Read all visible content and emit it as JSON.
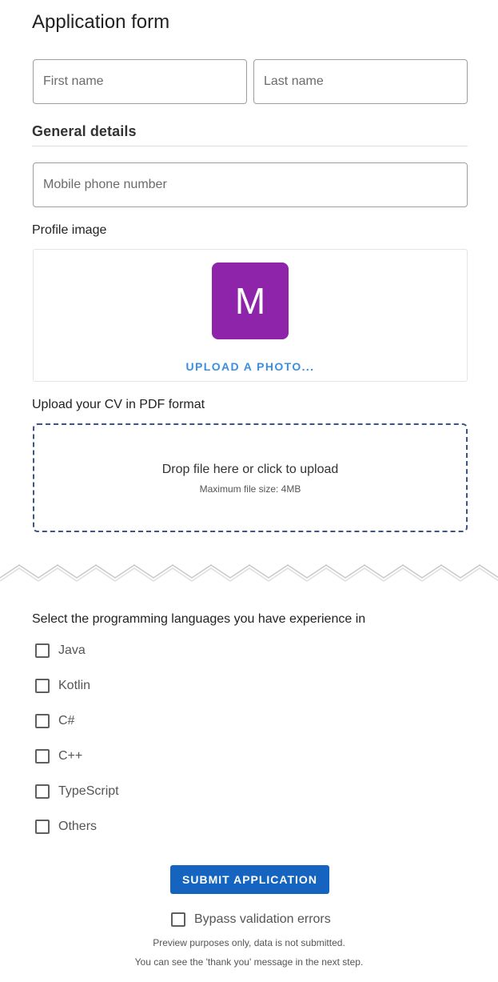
{
  "form": {
    "title": "Application form",
    "first_name_placeholder": "First name",
    "last_name_placeholder": "Last name",
    "general_details_heading": "General details",
    "phone_placeholder": "Mobile phone number",
    "profile_image_label": "Profile image",
    "avatar_initial": "M",
    "avatar_color": "#8e24aa",
    "upload_photo_label": "UPLOAD A PHOTO...",
    "cv_label": "Upload your CV in PDF format",
    "dropzone_text": "Drop file here or click to upload",
    "dropzone_subtext": "Maximum file size: 4MB",
    "languages_question": "Select the programming languages you have experience in",
    "languages": [
      {
        "label": "Java",
        "checked": false
      },
      {
        "label": "Kotlin",
        "checked": false
      },
      {
        "label": "C#",
        "checked": false
      },
      {
        "label": "C++",
        "checked": false
      },
      {
        "label": "TypeScript",
        "checked": false
      },
      {
        "label": "Others",
        "checked": false
      }
    ],
    "submit_label": "SUBMIT APPLICATION",
    "submit_color": "#1565c0",
    "bypass_label": "Bypass validation errors",
    "note_line1": "Preview purposes only, data is not submitted.",
    "note_line2": "You can see the 'thank you' message in the next step."
  }
}
